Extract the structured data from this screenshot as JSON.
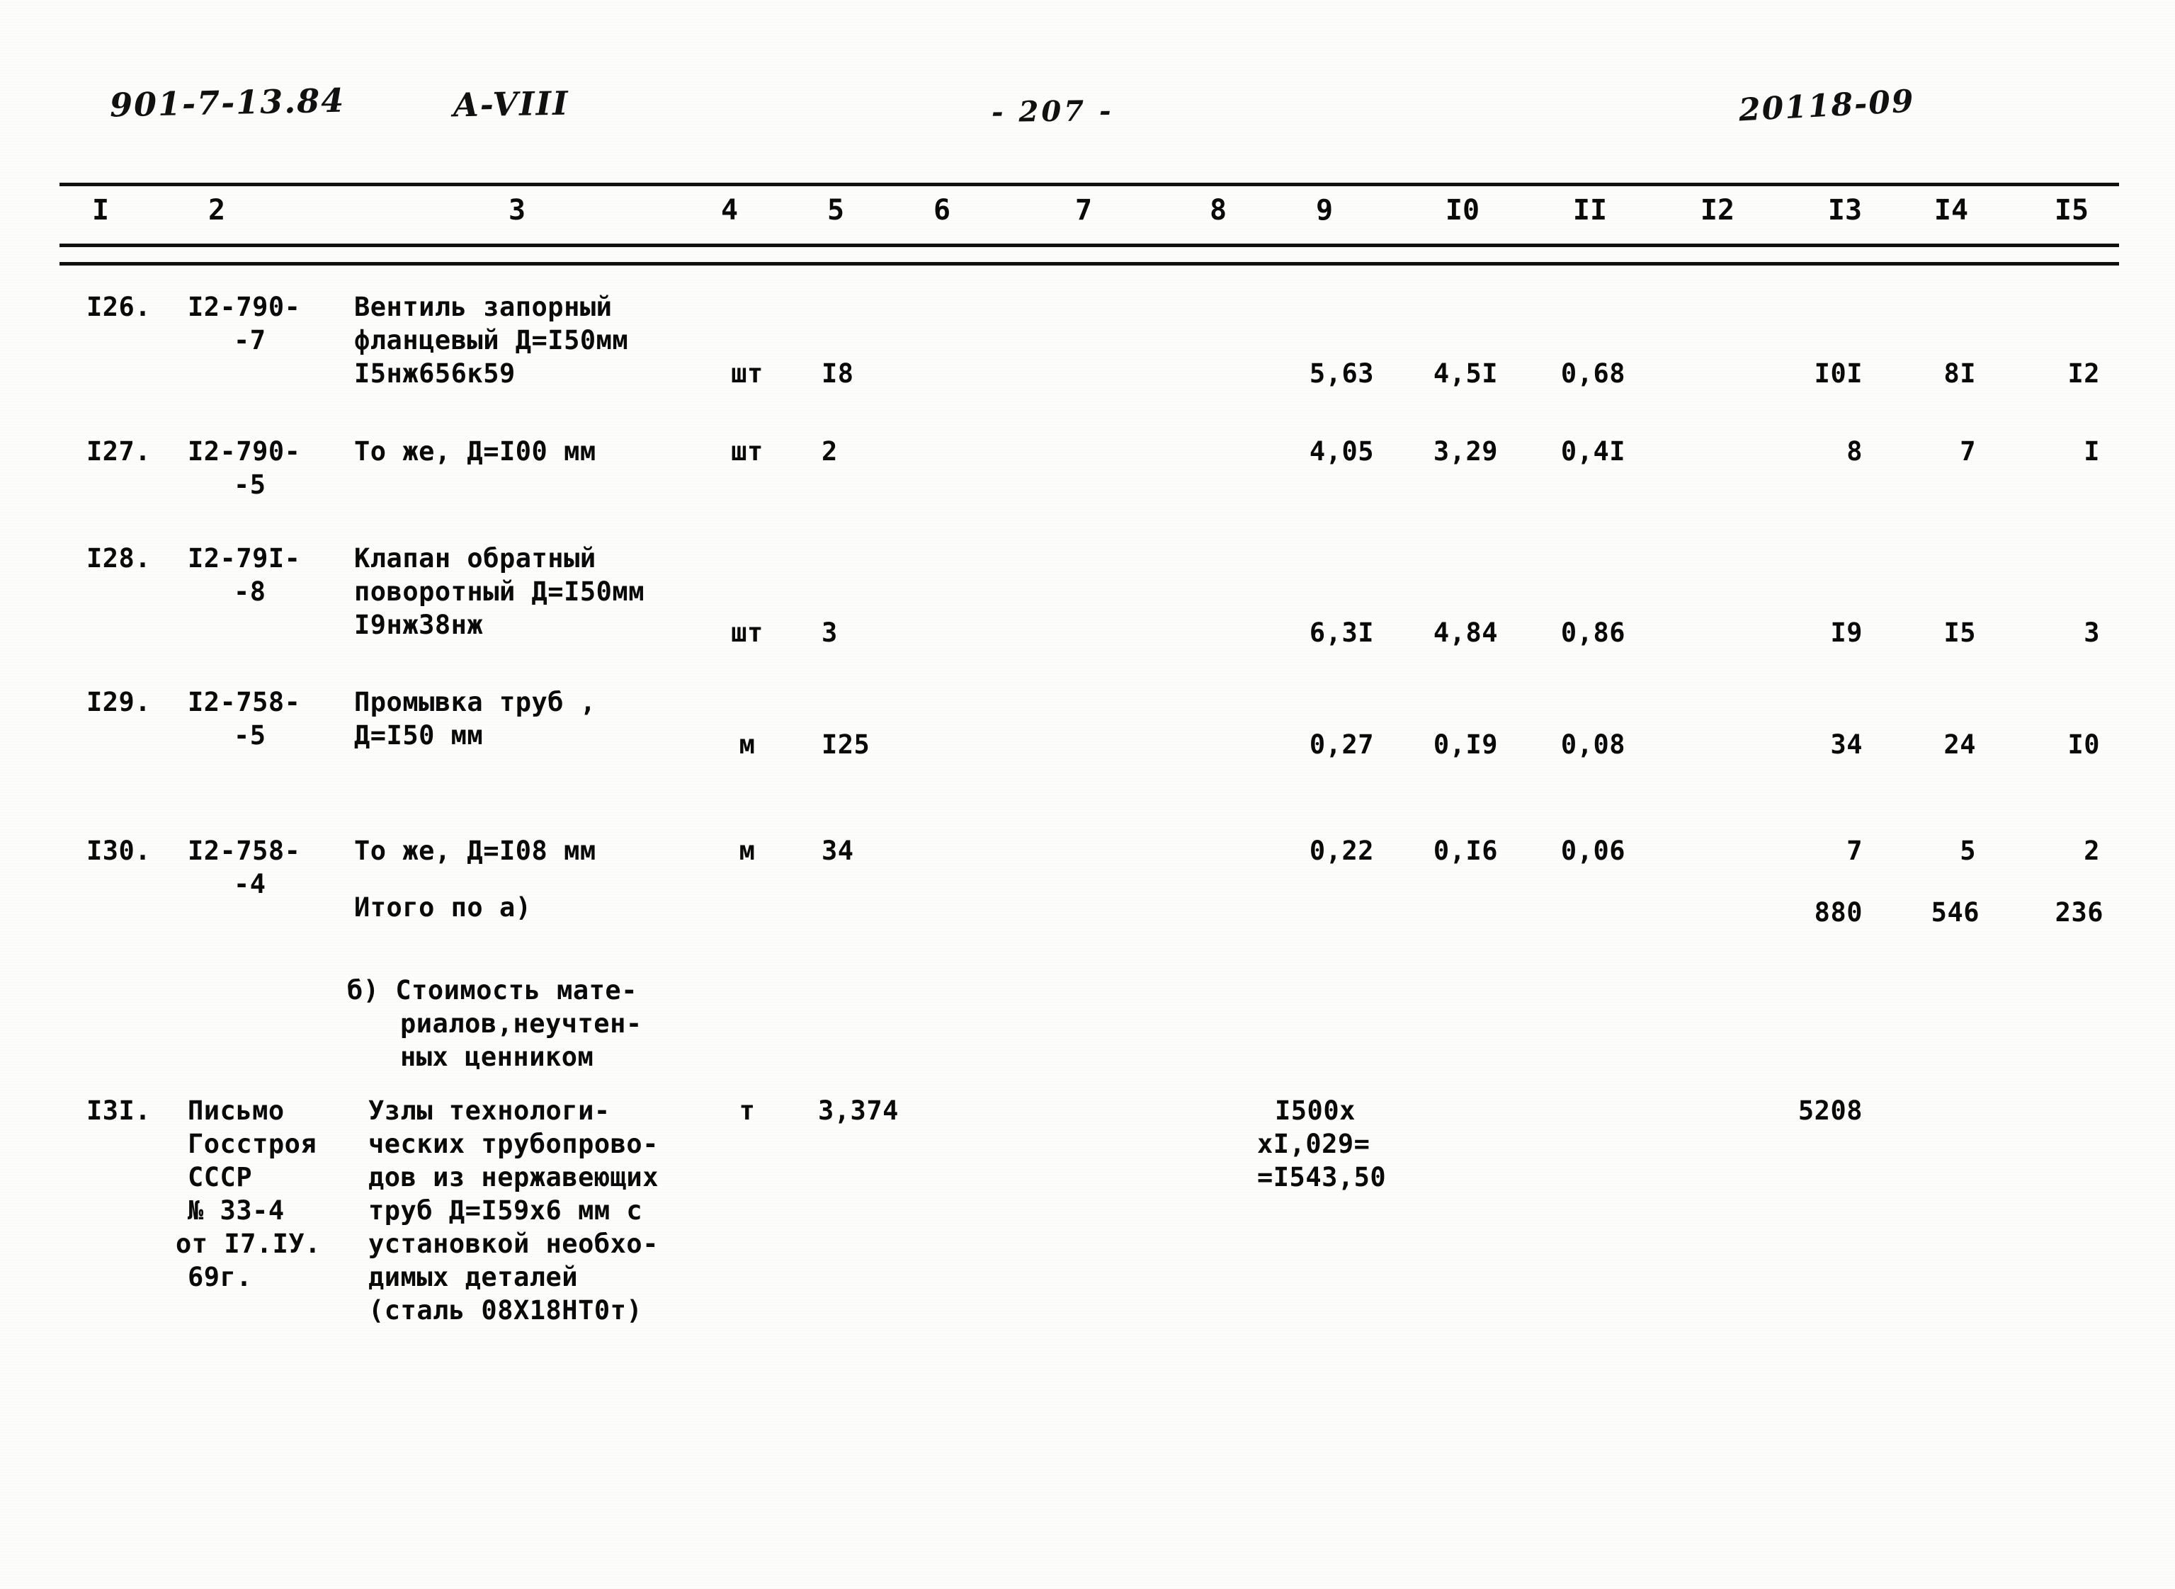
{
  "header": {
    "doc_code": "901-7-13.84",
    "album": "A-VIII",
    "page_number": "- 207 -",
    "archive_code": "20118-09"
  },
  "table": {
    "column_headers": [
      "I",
      "2",
      "3",
      "4",
      "5",
      "6",
      "7",
      "8",
      "9",
      "I0",
      "II",
      "I2",
      "I3",
      "I4",
      "I5"
    ],
    "rows": [
      {
        "no": "I26.",
        "code": [
          "I2-790-",
          "-7"
        ],
        "name": [
          "Вентиль запорный",
          "фланцевый Д=I50мм",
          "I5нж656к59"
        ],
        "unit": "шт",
        "qty": "I8",
        "c9": "5,63",
        "c10": "4,5I",
        "c11": "0,68",
        "c13": "I0I",
        "c14": "8I",
        "c15": "I2"
      },
      {
        "no": "I27.",
        "code": [
          "I2-790-",
          "-5"
        ],
        "name": [
          "То же, Д=I00 мм"
        ],
        "unit": "шт",
        "qty": "2",
        "c9": "4,05",
        "c10": "3,29",
        "c11": "0,4I",
        "c13": "8",
        "c14": "7",
        "c15": "I"
      },
      {
        "no": "I28.",
        "code": [
          "I2-79I-",
          "-8"
        ],
        "name": [
          "Клапан обратный",
          "поворотный Д=I50мм",
          "I9нж38нж"
        ],
        "unit": "шт",
        "qty": "3",
        "c9": "6,3I",
        "c10": "4,84",
        "c11": "0,86",
        "c13": "I9",
        "c14": "I5",
        "c15": "3"
      },
      {
        "no": "I29.",
        "code": [
          "I2-758-",
          "-5"
        ],
        "name": [
          "Промывка труб ,",
          "Д=I50 мм"
        ],
        "unit": "м",
        "qty": "I25",
        "c9": "0,27",
        "c10": "0,I9",
        "c11": "0,08",
        "c13": "34",
        "c14": "24",
        "c15": "I0"
      },
      {
        "no": "I30.",
        "code": [
          "I2-758-",
          "-4"
        ],
        "name": [
          "То же, Д=I08 мм"
        ],
        "unit": "м",
        "qty": "34",
        "c9": "0,22",
        "c10": "0,I6",
        "c11": "0,06",
        "c13": "7",
        "c14": "5",
        "c15": "2"
      }
    ],
    "subtotal": {
      "label": "Итого по а)",
      "c13": "880",
      "c14": "546",
      "c15": "236"
    },
    "section_b": {
      "lines": [
        "б) Стоимость мате-",
        "риалов,неучтен-",
        "ных ценником"
      ]
    },
    "row_131": {
      "no": "I3I.",
      "source": [
        "Письмо",
        "Госстроя",
        "СССР",
        "№ 33-4",
        "от I7.IУ.",
        "69г."
      ],
      "name": [
        "Узлы технологи-",
        "ческих трубопрово-",
        "дов из нержавеющих",
        "труб Д=I59х6 мм с",
        "установкой необхо-",
        "димых деталей",
        "(сталь 08Х18НТ0т)"
      ],
      "unit": "т",
      "qty": "3,374",
      "calc": [
        "I500х",
        "хI,029=",
        "=I543,50"
      ],
      "c13": "5208"
    }
  }
}
